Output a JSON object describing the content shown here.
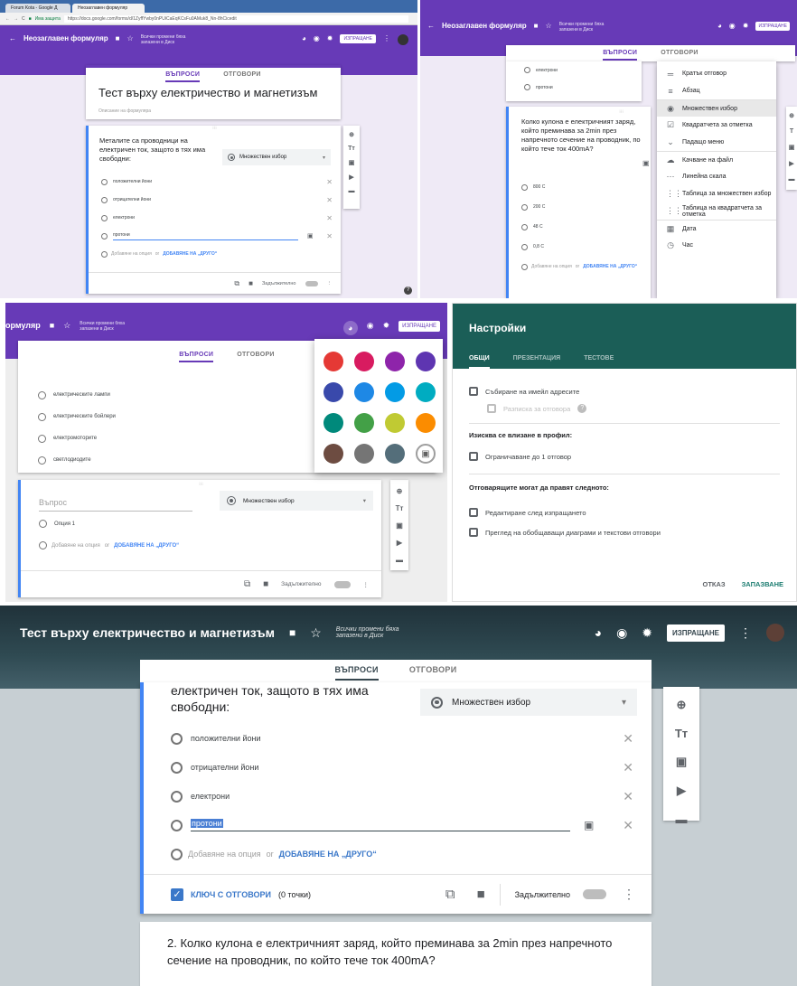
{
  "p1": {
    "browser_tabs": [
      "Forum Kota - Google Д",
      "Неозаглавен формуляр"
    ],
    "secure_label": "Има защита",
    "url": "https://docs.google.com/forms/d/1ZyffYwby0nPUiCaEqKCsFu0AMuk8_Nn-8hCicedit",
    "form_title": "Неозаглавен формуляр",
    "save_status": "Всички промени бяха запазени в Диск",
    "send_button": "ИЗПРАЩАНЕ",
    "tab_questions": "ВЪПРОСИ",
    "tab_answers": "ОТГОВОРИ",
    "quiz_title": "Тест върху електричество и магнетизъм",
    "description_placeholder": "Описание на формуляра",
    "question": "Металите са проводници на електричен ток, защото в тях има свободни:",
    "type": "Множествен избор",
    "options": [
      "положителни йони",
      "отрицателни йони",
      "електрони",
      "протони"
    ],
    "add_option": "Добавяне на опция",
    "or": "or",
    "add_other": "ДОБАВЯНЕ НА „ДРУГО“",
    "required": "Задължително"
  },
  "p2": {
    "form_title": "Неозаглавен формуляр",
    "save_status": "Всички промени бяха запазени в Диск",
    "send_button": "ИЗПРАЩАНЕ",
    "tab_questions": "ВЪПРОСИ",
    "tab_answers": "ОТГОВОРИ",
    "prev_options": [
      "електрони",
      "протони"
    ],
    "question": "Колко кулона е електричният заряд, който преминава за 2min през напречното сечение на проводник, по който тече ток 400mA?",
    "options": [
      "800 C",
      "200 C",
      "48 C",
      "0,8 C"
    ],
    "add_option": "Добавяне на опция",
    "or": "or",
    "add_other": "ДОБАВЯНЕ НА „ДРУГО“",
    "menu": [
      {
        "icon": "short-answer-icon",
        "glyph": "═",
        "label": "Кратък отговор"
      },
      {
        "icon": "paragraph-icon",
        "glyph": "≡",
        "label": "Абзац"
      },
      {
        "icon": "multiple-choice-icon",
        "glyph": "◉",
        "label": "Множествен избор"
      },
      {
        "icon": "checkbox-icon",
        "glyph": "☑",
        "label": "Квадратчета за отметка"
      },
      {
        "icon": "dropdown-icon",
        "glyph": "⌄",
        "label": "Падащо меню"
      },
      {
        "icon": "file-upload-icon",
        "glyph": "☁",
        "label": "Качване на файл"
      },
      {
        "icon": "linear-scale-icon",
        "glyph": "⋯",
        "label": "Линейна скала"
      },
      {
        "icon": "grid-icon",
        "glyph": "⋮⋮",
        "label": "Таблица за множествен избор"
      },
      {
        "icon": "checkbox-grid-icon",
        "glyph": "⋮⋮",
        "label": "Таблица на квадратчета за отметка"
      },
      {
        "icon": "date-icon",
        "glyph": "▦",
        "label": "Дата"
      },
      {
        "icon": "time-icon",
        "glyph": "◷",
        "label": "Час"
      }
    ]
  },
  "p3": {
    "form_title": "ормуляр",
    "save_status": "Всички промени бяха запазени в Диск",
    "send_button": "ИЗПРАЩАНЕ",
    "tab_questions": "ВЪПРОСИ",
    "tab_answers": "ОТГОВОРИ",
    "options": [
      "електрическите лампи",
      "електрическите бойлери",
      "електромоторите",
      "светлодиодите"
    ],
    "question_placeholder": "Въпрос",
    "type": "Множествен избор",
    "option1": "Опция 1",
    "add_option": "Добавяне на опция",
    "or": "or",
    "add_other": "ДОБАВЯНЕ НА „ДРУГО“",
    "required": "Задължително",
    "palette": [
      "#e53935",
      "#d81b60",
      "#8e24aa",
      "#5e35b1",
      "#3949ab",
      "#1e88e5",
      "#039be5",
      "#00acc1",
      "#00897b",
      "#43a047",
      "#c0ca33",
      "#fb8c00",
      "#6d4c41",
      "#757575",
      "#546e7a"
    ]
  },
  "p4": {
    "title": "Настройки",
    "tabs": [
      "ОБЩИ",
      "ПРЕЗЕНТАЦИЯ",
      "ТЕСТОВЕ"
    ],
    "collect_emails": "Събиране на имейл адресите",
    "response_receipt": "Разписка за отговора",
    "login_heading": "Изисква се влизане в профил:",
    "limit_one": "Ограничаване до 1 отговор",
    "respondents_heading": "Отговарящите могат да правят следното:",
    "edit_after": "Редактиране след изпращането",
    "see_summary": "Преглед на обобщаващи диаграми и текстови отговори",
    "cancel": "ОТКАЗ",
    "save": "ЗАПАЗВАНЕ"
  },
  "p5": {
    "quiz_title": "Тест върху електричество и магнетизъм",
    "save_status": "Всички промени бяха запазени в Диск",
    "send_button": "ИЗПРАЩАНЕ",
    "tab_questions": "ВЪПРОСИ",
    "tab_answers": "ОТГОВОРИ",
    "question_partial": "електричен ток, защото в тях има свободни:",
    "type": "Множествен избор",
    "options": [
      "положителни йони",
      "отрицателни йони",
      "електрони",
      "протони"
    ],
    "add_option": "Добавяне на опция",
    "or": "or",
    "add_other": "ДОБАВЯНЕ НА „ДРУГО“",
    "answer_key": "КЛЮЧ С ОТГОВОРИ",
    "points": "(0 точки)",
    "required": "Задължително",
    "next_question": "2. Колко кулона е електричният заряд, който преминава за 2min през напречното сечение на проводник, по който тече ток 400mA?"
  }
}
